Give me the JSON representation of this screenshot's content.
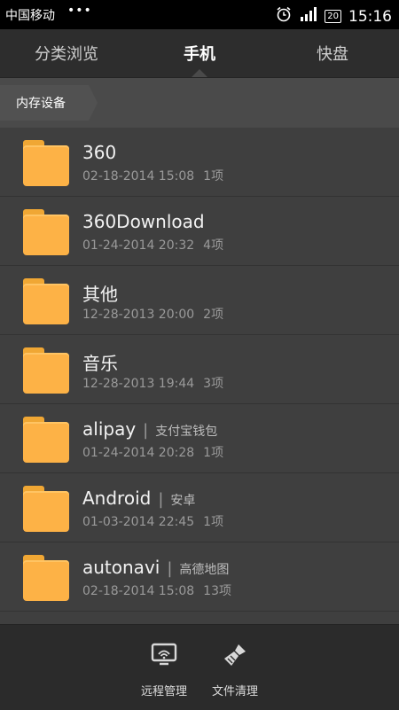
{
  "status": {
    "carrier": "中国移动",
    "dots": "•••",
    "battery": "20",
    "time": "15:16"
  },
  "tabs": [
    {
      "label": "分类浏览"
    },
    {
      "label": "手机"
    },
    {
      "label": "快盘"
    }
  ],
  "breadcrumb": "内存设备",
  "files": [
    {
      "name": "360",
      "alias": "",
      "date": "02-18-2014 15:08",
      "count": "1项"
    },
    {
      "name": "360Download",
      "alias": "",
      "date": "01-24-2014 20:32",
      "count": "4项"
    },
    {
      "name": "其他",
      "alias": "",
      "date": "12-28-2013 20:00",
      "count": "2项"
    },
    {
      "name": "音乐",
      "alias": "",
      "date": "12-28-2013 19:44",
      "count": "3项"
    },
    {
      "name": "alipay",
      "alias": "支付宝钱包",
      "date": "01-24-2014 20:28",
      "count": "1项"
    },
    {
      "name": "Android",
      "alias": "安卓",
      "date": "01-03-2014 22:45",
      "count": "1项"
    },
    {
      "name": "autonavi",
      "alias": "高德地图",
      "date": "02-18-2014 15:08",
      "count": "13项"
    }
  ],
  "bottom": {
    "remote_label": "远程管理",
    "clean_label": "文件清理"
  },
  "colors": {
    "folder": "#fdb246",
    "background": "#3c3c3c"
  }
}
